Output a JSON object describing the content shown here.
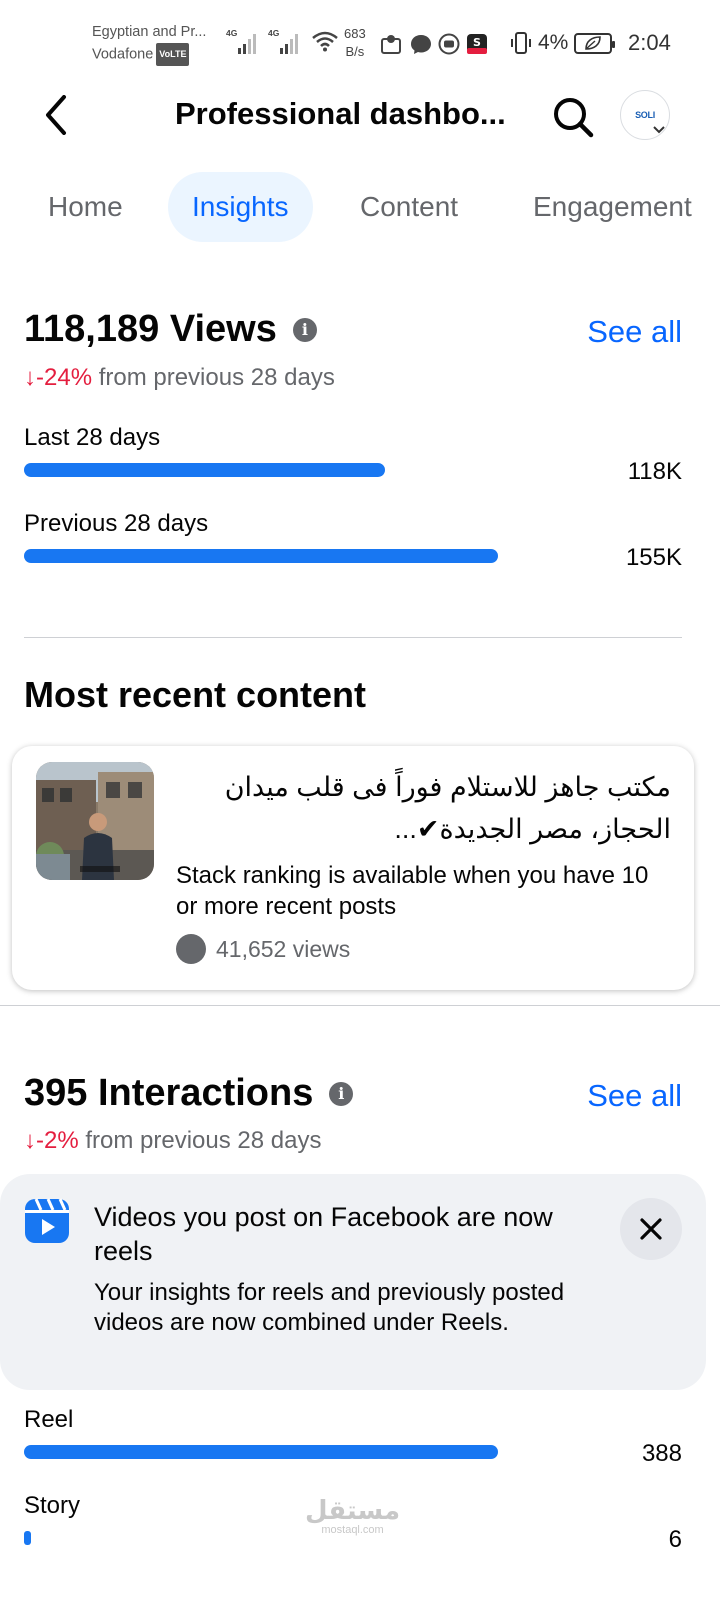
{
  "status_bar": {
    "carrier_line1": "Egyptian and Pr...",
    "carrier_line2": "Vodafone",
    "volte": "VoLTE",
    "net1": "4G",
    "net2": "4G",
    "speed_value": "683",
    "speed_unit": "B/s",
    "battery_percent": "4%",
    "time": "2:04"
  },
  "header": {
    "title": "Professional dashbo...",
    "avatar_text": "SOLI",
    "icons": [
      "back-arrow-icon",
      "search-icon",
      "chevron-down-icon"
    ]
  },
  "tabs": [
    {
      "label": "Home",
      "active": false
    },
    {
      "label": "Insights",
      "active": true
    },
    {
      "label": "Content",
      "active": false
    },
    {
      "label": "Engagement",
      "active": false
    }
  ],
  "views": {
    "headline": "118,189 Views",
    "see_all": "See all",
    "trend_arrow": "↓",
    "trend_pct": "-24%",
    "trend_text": "from previous 28 days",
    "bars": [
      {
        "label": "Last 28 days",
        "value": "118K",
        "fraction": 0.762
      },
      {
        "label": "Previous 28 days",
        "value": "155K",
        "fraction": 1.0
      }
    ]
  },
  "recent": {
    "title": "Most recent content",
    "post_title": "مكتب جاهز للاستلام فوراً فى قلب ميدان الحجاز، مصر الجديدة✔...",
    "note": "Stack ranking is available when you have 10 or more recent posts",
    "views": "41,652 views"
  },
  "interactions": {
    "headline": "395 Interactions",
    "see_all": "See all",
    "trend_arrow": "↓",
    "trend_pct": "-2%",
    "trend_text": "from previous 28 days",
    "bars": [
      {
        "label": "Reel",
        "value": "388",
        "fraction": 1.0
      },
      {
        "label": "Story",
        "value": "6",
        "fraction": 0.0155
      }
    ]
  },
  "notice": {
    "title": "Videos you post on Facebook are now reels",
    "body": "Your insights for reels and previously posted videos are now combined under Reels.",
    "icons": [
      "reels-icon",
      "close-icon"
    ]
  },
  "watermark": {
    "arabic": "مستقل",
    "latin": "mostaql.com"
  },
  "colors": {
    "accent": "#0866ff",
    "bar": "#1877f2",
    "negative": "#e41e3f",
    "secondary_text": "#65676b"
  }
}
